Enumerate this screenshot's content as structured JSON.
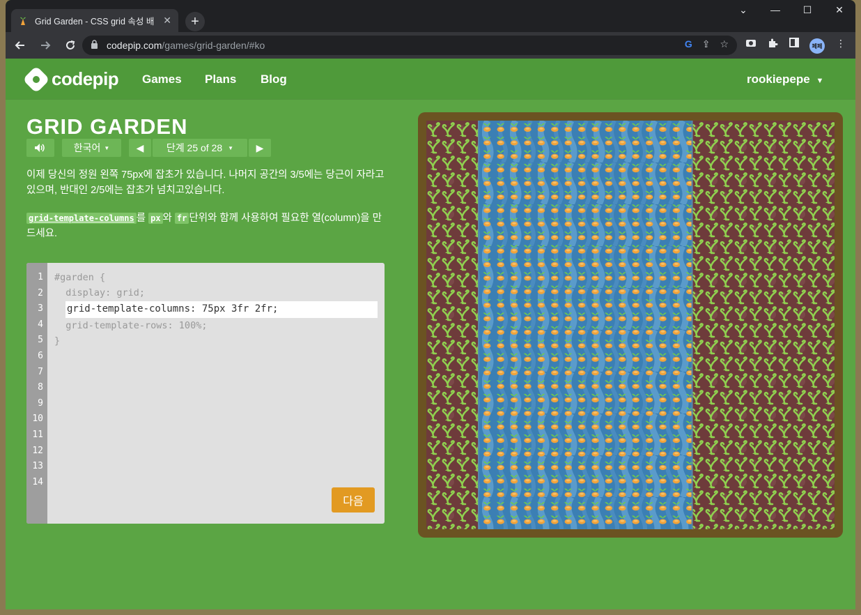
{
  "browser": {
    "tab_title": "Grid Garden - CSS grid 속성 배",
    "url_host": "codepip.com",
    "url_path": "/games/grid-garden/#ko",
    "profile_label": "페페"
  },
  "site": {
    "logo_text": "codepip",
    "nav": [
      "Games",
      "Plans",
      "Blog"
    ],
    "user": "rookiepepe"
  },
  "game": {
    "title": "GRID GARDEN",
    "language": "한국어",
    "level": "단계 25 of 28",
    "instructions": {
      "para1": "이제 당신의 정원 왼쪽 75px에 잡초가 있습니다. 나머지 공간의 3/5에는 당근이 자라고 있으며, 반대인 2/5에는 잡초가 넘치고있습니다.",
      "code_prop": "grid-template-columns",
      "text_a": "를 ",
      "code_px": "px",
      "text_b": "와 ",
      "code_fr": "fr",
      "text_c": "단위와 함께 사용하여 필요한 열(column)을 만드세요."
    },
    "editor": {
      "line_numbers": [
        "1",
        "2",
        "3",
        "4",
        "5",
        "6",
        "7",
        "8",
        "9",
        "10",
        "11",
        "12",
        "13",
        "14"
      ],
      "line1": "#garden {",
      "line2": "  display: grid;",
      "input_value": "grid-template-columns: 75px 3fr 2fr;",
      "line4": "  grid-template-rows: 100%;",
      "line5": "}"
    },
    "next_button": "다음"
  },
  "garden": {
    "columns": [
      "75px",
      "3fr",
      "2fr"
    ],
    "colors": {
      "border": "#6b5322",
      "soil": "#6e3b3b",
      "water": "#3b7fb4",
      "weed": "#8fd14f",
      "carrot": "#f2a33a",
      "carrot_leaf": "#6fce4a"
    },
    "layers": {
      "weed_columns": [
        1,
        3
      ],
      "carrot_column": 2
    }
  }
}
